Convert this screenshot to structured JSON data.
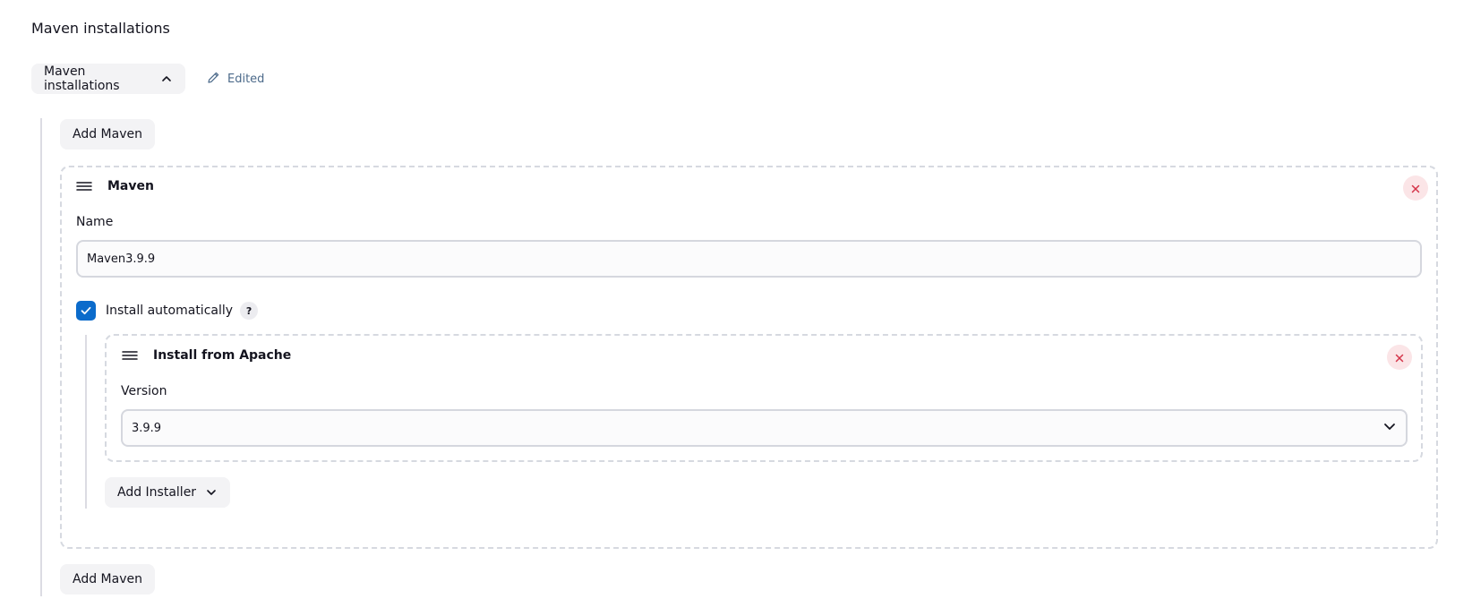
{
  "section": {
    "title": "Maven installations",
    "toggle_label": "Maven installations",
    "edited_label": "Edited"
  },
  "add_maven_top_label": "Add Maven",
  "add_maven_bottom_label": "Add Maven",
  "maven_card": {
    "title": "Maven",
    "name_label": "Name",
    "name_value": "Maven3.9.9",
    "install_auto_label": "Install automatically",
    "install_auto_checked": true,
    "help_label": "?"
  },
  "installer_card": {
    "title": "Install from Apache",
    "version_label": "Version",
    "version_value": "3.9.9"
  },
  "add_installer_label": "Add Installer",
  "colors": {
    "accent": "#0b6bcb",
    "danger": "#d5354a",
    "edited": "#4c6a8a"
  }
}
